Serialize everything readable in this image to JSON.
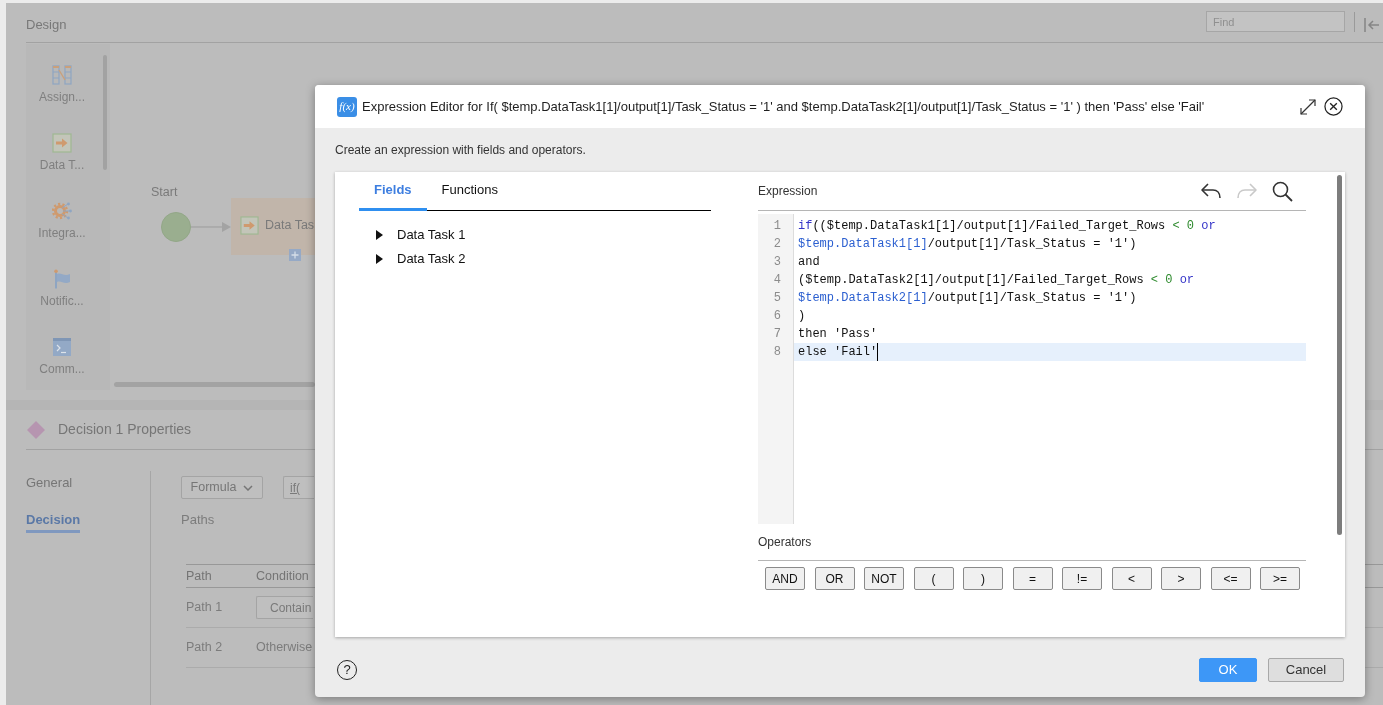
{
  "app": {
    "title": "Design",
    "find": {
      "placeholder": "Find"
    },
    "palette": [
      {
        "kind": "assignment",
        "label": "Assign..."
      },
      {
        "kind": "data_task",
        "label": "Data T..."
      },
      {
        "kind": "integration",
        "label": "Integra..."
      },
      {
        "kind": "notification",
        "label": "Notific..."
      },
      {
        "kind": "command",
        "label": "Comm..."
      }
    ],
    "canvas": {
      "nodes": [
        {
          "kind": "start",
          "label": "Start"
        },
        {
          "kind": "task",
          "label": "Data Tas"
        }
      ]
    },
    "properties": {
      "title": "Decision 1 Properties",
      "tabs": [
        {
          "label": "General",
          "selected": false
        },
        {
          "label": "Decision",
          "selected": true
        }
      ],
      "mode": "Formula",
      "formula_button": "if(",
      "paths_label": "Paths",
      "table": {
        "columns": [
          "Path",
          "Condition"
        ],
        "rows": [
          {
            "path": "Path 1",
            "condition": "Contain",
            "kind": "button"
          },
          {
            "path": "Path 2",
            "condition": "Otherwise",
            "kind": "text"
          }
        ]
      }
    }
  },
  "dialog": {
    "title_icon": "f(x)",
    "title": "Expression Editor for If( $temp.DataTask1[1]/output[1]/Task_Status = '1' and $temp.DataTask2[1]/output[1]/Task_Status = '1' ) then 'Pass' else 'Fail'",
    "subtitle": "Create an expression with fields and operators.",
    "tabs": [
      {
        "label": "Fields",
        "selected": true
      },
      {
        "label": "Functions",
        "selected": false
      }
    ],
    "tree": [
      {
        "label": "Data Task 1",
        "expanded": false
      },
      {
        "label": "Data Task 2",
        "expanded": false
      }
    ],
    "expression": {
      "label": "Expression",
      "toolbar": [
        {
          "kind": "undo",
          "disabled": false
        },
        {
          "kind": "redo",
          "disabled": true
        },
        {
          "kind": "search",
          "disabled": false
        }
      ],
      "lines": [
        {
          "number": "1",
          "current": false,
          "tokens": [
            {
              "kind": "keyword",
              "text": "if"
            },
            {
              "kind": "plain",
              "text": "(($temp.DataTask1[1]/output[1]/Failed_Target_Rows "
            },
            {
              "kind": "operator",
              "text": "< 0"
            },
            {
              "kind": "keyword",
              "text": " or"
            }
          ]
        },
        {
          "number": "2",
          "current": false,
          "tokens": [
            {
              "kind": "field",
              "text": "$temp.DataTask1[1]"
            },
            {
              "kind": "plain",
              "text": "/output[1]/Task_Status = '1')"
            }
          ]
        },
        {
          "number": "3",
          "current": false,
          "tokens": [
            {
              "kind": "plain",
              "text": "and"
            }
          ]
        },
        {
          "number": "4",
          "current": false,
          "tokens": [
            {
              "kind": "plain",
              "text": "($temp.DataTask2[1]/output[1]/Failed_Target_Rows "
            },
            {
              "kind": "operator",
              "text": "< 0"
            },
            {
              "kind": "keyword",
              "text": " or"
            }
          ]
        },
        {
          "number": "5",
          "current": false,
          "tokens": [
            {
              "kind": "field",
              "text": "$temp.DataTask2[1]"
            },
            {
              "kind": "plain",
              "text": "/output[1]/Task_Status = '1')"
            }
          ]
        },
        {
          "number": "6",
          "current": false,
          "tokens": [
            {
              "kind": "plain",
              "text": ")"
            }
          ]
        },
        {
          "number": "7",
          "current": false,
          "tokens": [
            {
              "kind": "plain",
              "text": "then 'Pass'"
            }
          ]
        },
        {
          "number": "8",
          "current": true,
          "tokens": [
            {
              "kind": "plain",
              "text": "else 'Fail'"
            }
          ]
        }
      ]
    },
    "operators": {
      "label": "Operators",
      "buttons": [
        "AND",
        "OR",
        "NOT",
        "(",
        ")",
        "=",
        "!=",
        "<",
        ">",
        "<=",
        ">="
      ]
    },
    "help": "?",
    "buttons": [
      {
        "label": "OK",
        "kind": "primary"
      },
      {
        "label": "Cancel",
        "kind": "secondary"
      }
    ]
  }
}
